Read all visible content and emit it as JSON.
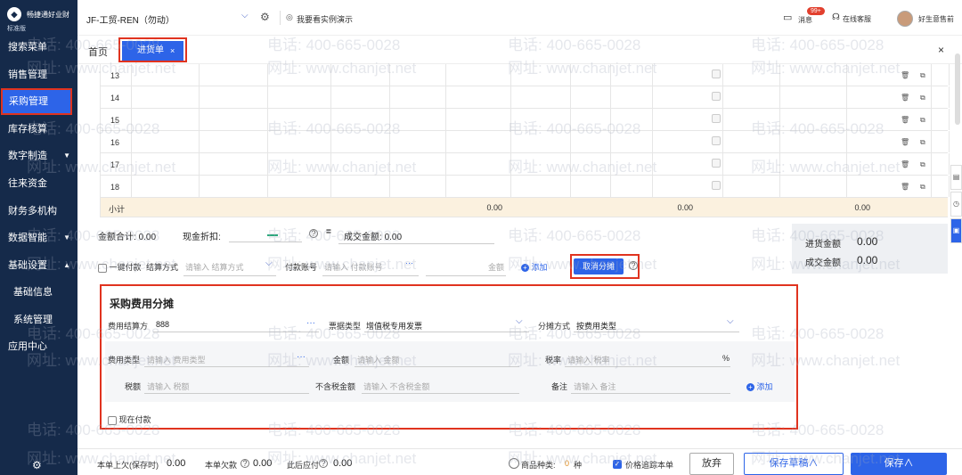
{
  "sidebar": {
    "logo_text": "畅捷通好业财",
    "logo_sub": "标准版",
    "items": [
      {
        "label": "搜索菜单",
        "arrow": ""
      },
      {
        "label": "销售管理",
        "arrow": ""
      },
      {
        "label": "采购管理",
        "arrow": ""
      },
      {
        "label": "库存核算",
        "arrow": ""
      },
      {
        "label": "数字制造",
        "arrow": "▼"
      },
      {
        "label": "往来资金",
        "arrow": ""
      },
      {
        "label": "财务多机构",
        "arrow": ""
      },
      {
        "label": "数据智能",
        "arrow": "▼"
      },
      {
        "label": "基础设置",
        "arrow": "▲"
      },
      {
        "label": "基础信息",
        "arrow": ""
      },
      {
        "label": "系统管理",
        "arrow": ""
      },
      {
        "label": "应用中心",
        "arrow": ""
      }
    ]
  },
  "topbar": {
    "company": "JF-工贸-REN（勿动）",
    "demo_label": "我要看实例演示",
    "message_label": "消息",
    "message_badge": "99+",
    "service_label": "在线客服",
    "user_label": "好生意售前"
  },
  "tabs": {
    "home": "首页",
    "active": "进货单",
    "active_close": "×",
    "window_close": "×"
  },
  "table": {
    "rows": [
      "13",
      "14",
      "15",
      "16",
      "17",
      "18"
    ],
    "subtotal_label": "小计",
    "subtotal_values": [
      "0.00",
      "0.00",
      "0.00"
    ]
  },
  "summary": {
    "total_label": "金额合计:",
    "total_value": "0.00",
    "discount_label": "现金折扣:",
    "deal_label": "成交金额:",
    "deal_value": "0.00",
    "panel_purchase_label": "进货金额",
    "panel_purchase_value": "0.00",
    "panel_deal_label": "成交金额",
    "panel_deal_value": "0.00"
  },
  "payment": {
    "one_click_label": "一键付款",
    "settle_label": "结算方式",
    "settle_placeholder": "请输入 结算方式",
    "account_label": "付款账号",
    "account_placeholder": "请输入 付款账号",
    "amount_label": "金额",
    "add_label": "添加",
    "cancel_alloc_label": "取消分摊"
  },
  "allocation": {
    "title": "采购费用分摊",
    "settle_party_label": "费用结算方",
    "settle_party_value": "888",
    "invoice_type_label": "票据类型",
    "invoice_type_value": "增值税专用发票",
    "alloc_method_label": "分摊方式",
    "alloc_method_value": "按费用类型",
    "fee_type_label": "费用类型",
    "fee_type_placeholder": "请输入 费用类型",
    "amount_label": "金额",
    "amount_placeholder": "请输入 金额",
    "tax_rate_label": "税率",
    "tax_rate_placeholder": "请输入 税率",
    "percent": "%",
    "tax_label": "税额",
    "tax_placeholder": "请输入 税额",
    "no_tax_label": "不含税金额",
    "no_tax_placeholder": "请输入 不含税金额",
    "remark_label": "备注",
    "remark_placeholder": "请输入 备注",
    "add_label": "添加",
    "pay_now_label": "现在付款"
  },
  "footer": {
    "prev_debt_label": "本单上欠(保存时)",
    "prev_debt_value": "0.00",
    "debt_label": "本单欠款",
    "debt_value": "0.00",
    "after_label": "此后应付",
    "after_value": "0.00",
    "kinds_label": "商品种类:",
    "kinds_value": "0",
    "kinds_unit": "种",
    "track_label": "价格追踪本单",
    "discard_label": "放弃",
    "save_draft_label": "保存草稿∧",
    "save_label": "保存∧"
  },
  "watermark": {
    "phone": "电话: 400-665-0028",
    "site": "网址: www.chanjet.net"
  }
}
